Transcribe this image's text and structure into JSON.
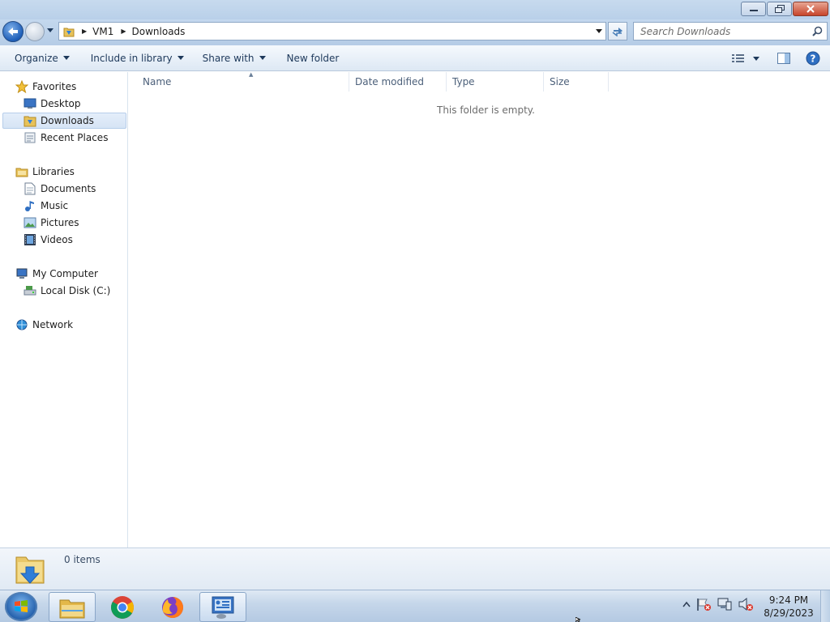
{
  "window": {
    "buttons": {
      "minimize_icon": "minimize-icon",
      "restore_icon": "restore-icon",
      "close_icon": "close-icon"
    }
  },
  "address_bar": {
    "breadcrumbs": [
      "VM1",
      "Downloads"
    ],
    "search_placeholder": "Search Downloads"
  },
  "toolbar": {
    "organize": "Organize",
    "include_in_library": "Include in library",
    "share_with": "Share with",
    "new_folder": "New folder"
  },
  "nav_pane": {
    "favorites": {
      "label": "Favorites",
      "items": [
        "Desktop",
        "Downloads",
        "Recent Places"
      ]
    },
    "libraries": {
      "label": "Libraries",
      "items": [
        "Documents",
        "Music",
        "Pictures",
        "Videos"
      ]
    },
    "computer": {
      "label": "My Computer",
      "items": [
        "Local Disk (C:)"
      ]
    },
    "network": {
      "label": "Network"
    },
    "selected": "Downloads"
  },
  "content": {
    "columns": [
      "Name",
      "Date modified",
      "Type",
      "Size"
    ],
    "empty_message": "This folder is empty."
  },
  "details": {
    "count": "0 items"
  },
  "taskbar": {
    "apps": [
      "windows-explorer",
      "google-chrome",
      "firefox",
      "control-panel"
    ],
    "time": "9:24 PM",
    "date": "8/29/2023"
  },
  "colors": {
    "chrome_blue": "#b9d0e9",
    "selection": "#d6e4f5",
    "toolbar_text": "#1e395b"
  }
}
